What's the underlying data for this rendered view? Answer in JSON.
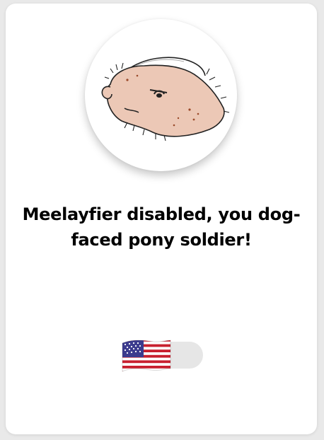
{
  "message": {
    "line1": "Meelayfier disabled, you dog-",
    "line2": "faced pony soldier!"
  },
  "toggle": {
    "state": "off"
  },
  "colors": {
    "track_off": "#e6e6e6",
    "card": "#ffffff",
    "skin": "#ecc8b6",
    "flag_red": "#c8202f",
    "flag_blue": "#3c3b8e"
  }
}
